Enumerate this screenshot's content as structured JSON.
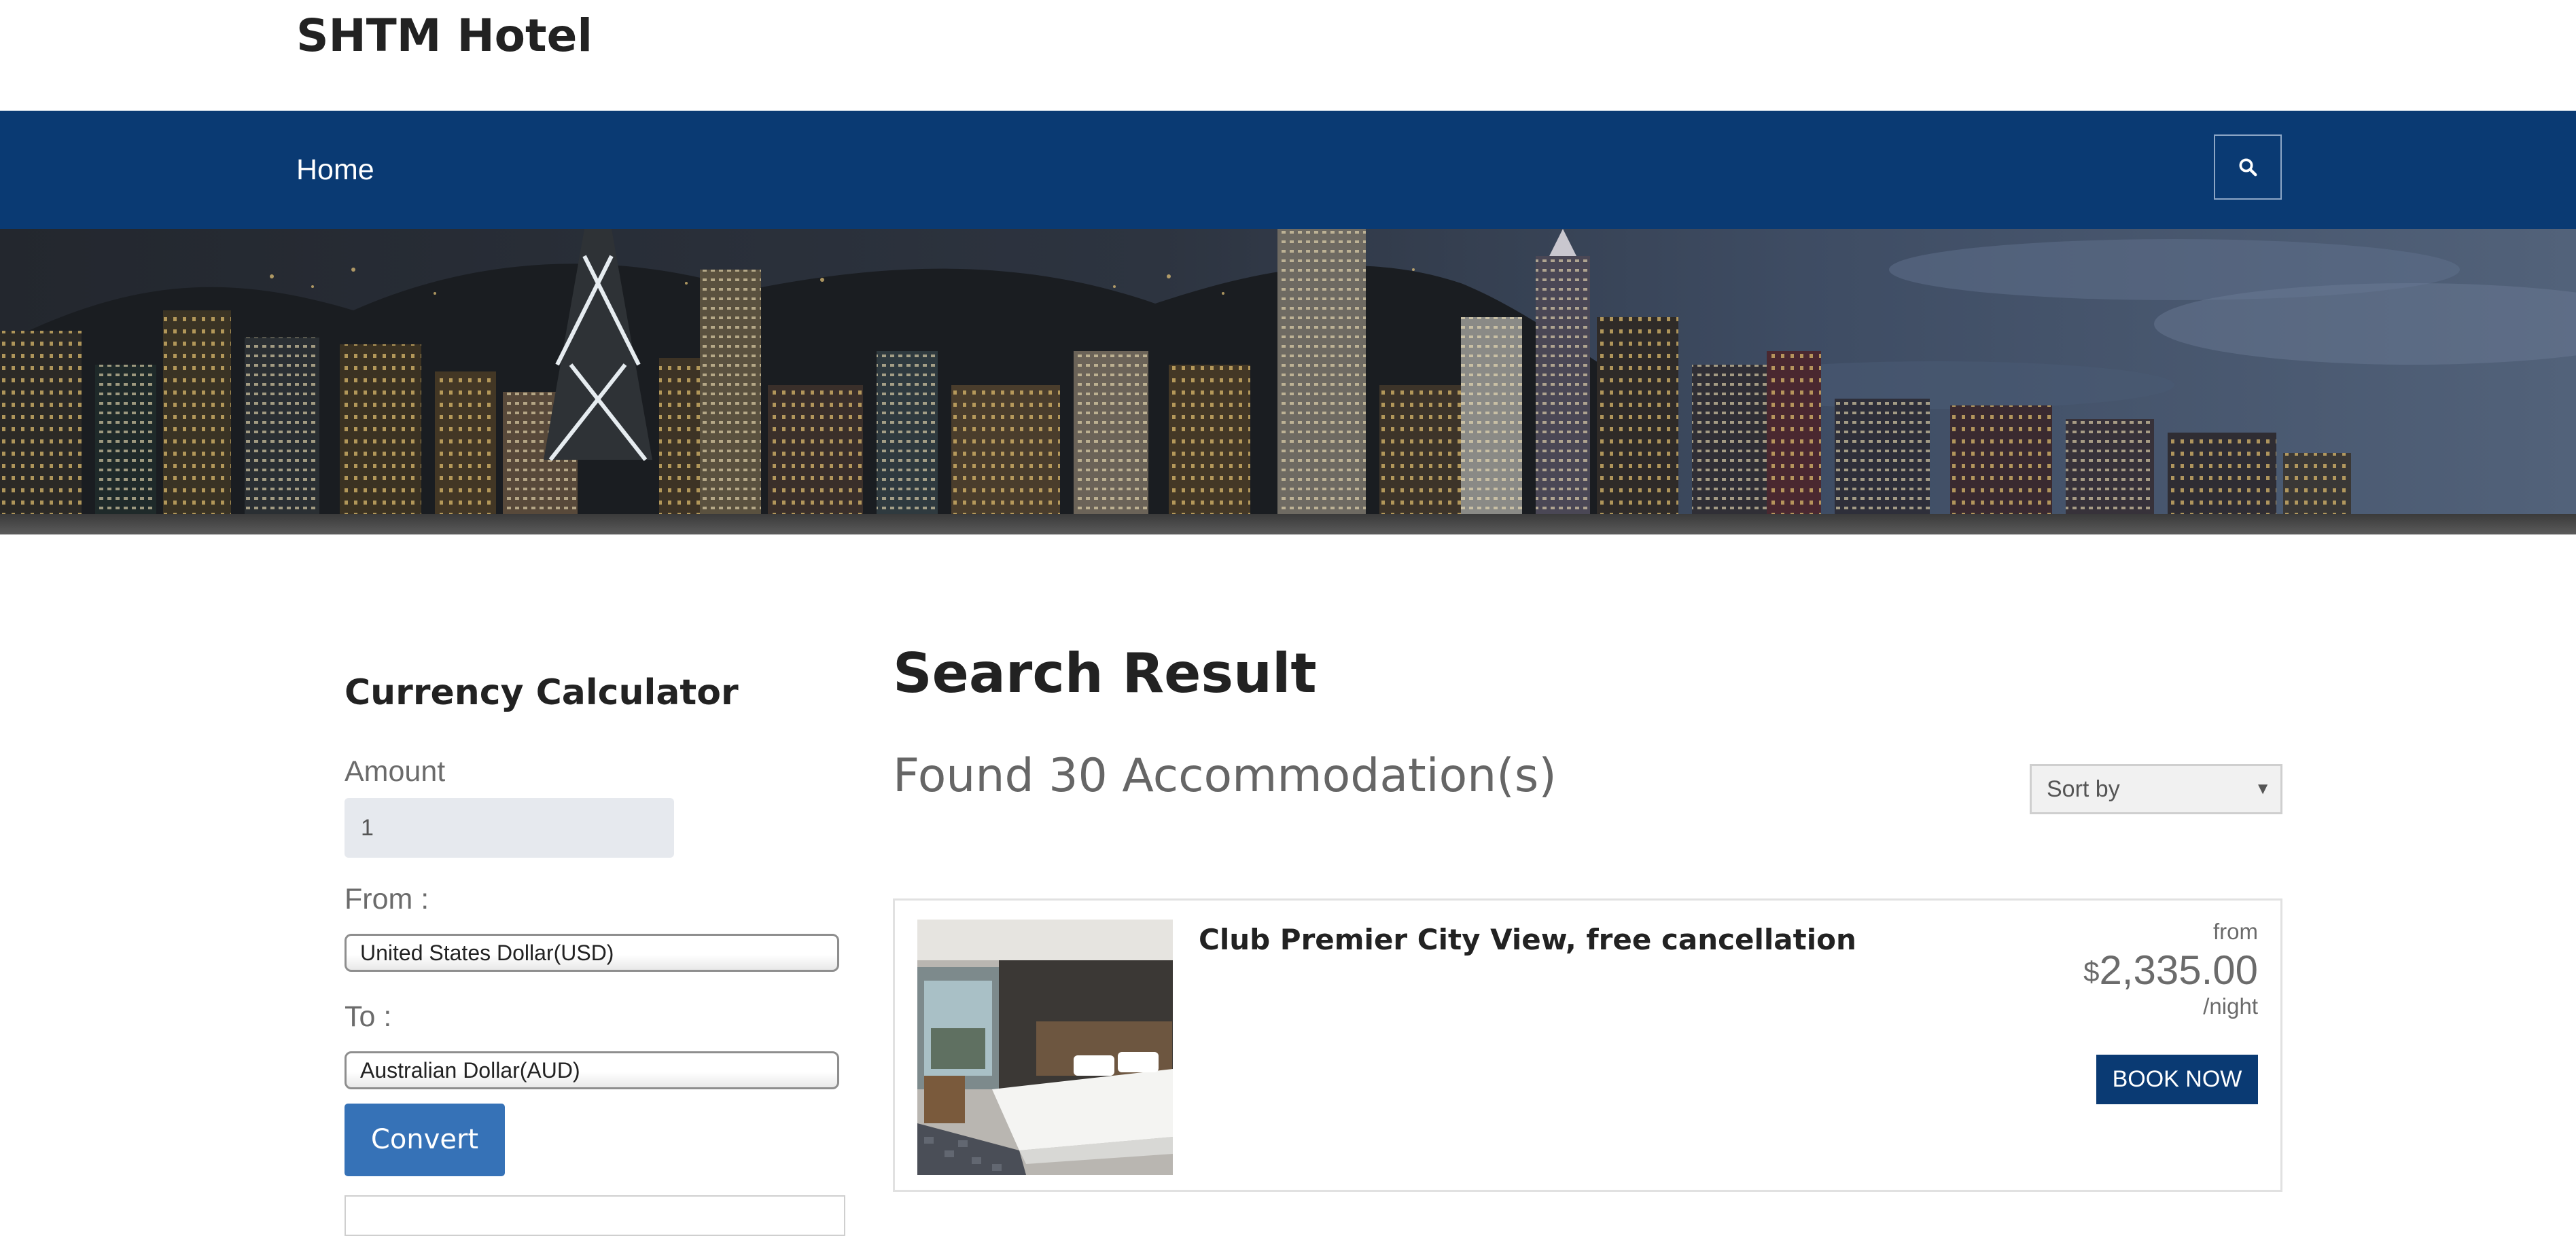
{
  "site": {
    "title": "SHTM Hotel"
  },
  "nav": {
    "home_label": "Home",
    "search_icon": "search-icon"
  },
  "colors": {
    "navbar": "#0a3a73",
    "convert_button": "#3672b7",
    "book_button": "#0a3a73"
  },
  "currency_calculator": {
    "title": "Currency Calculator",
    "amount_label": "Amount",
    "amount_value": "1",
    "from_label": "From :",
    "from_selected": "United States Dollar(USD)",
    "to_label": "To :",
    "to_selected": "Australian Dollar(AUD)",
    "convert_label": "Convert"
  },
  "results": {
    "title": "Search Result",
    "found_text": "Found 30 Accommodation(s)",
    "sort_placeholder": "Sort by",
    "items": [
      {
        "name": "Club Premier City View, free cancellation",
        "price_prefix": "from",
        "currency_symbol": "$",
        "price": "2,335.00",
        "price_unit": "/night",
        "book_label": "BOOK NOW"
      }
    ]
  }
}
